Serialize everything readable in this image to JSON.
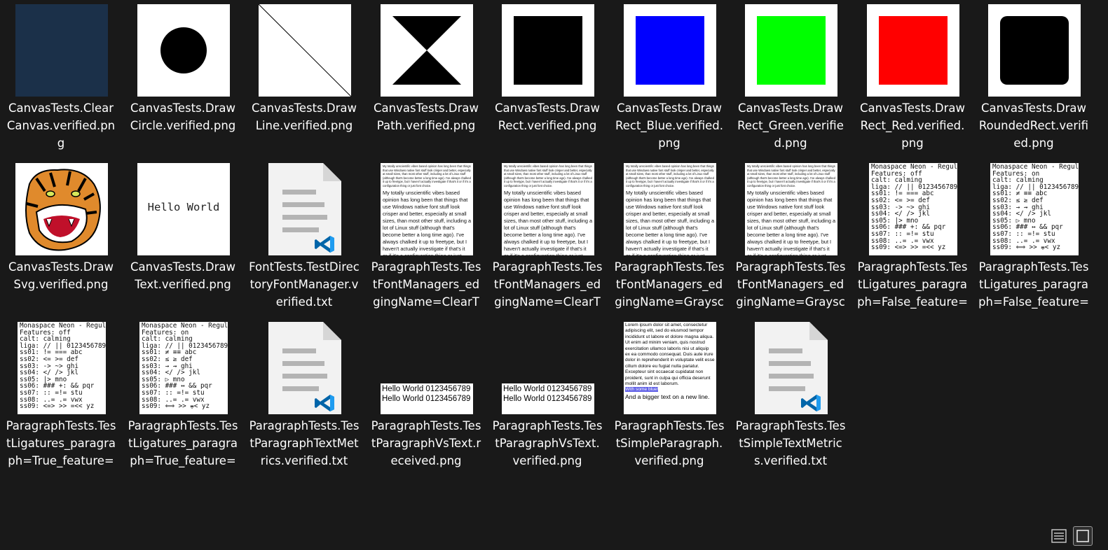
{
  "files": [
    {
      "name": "CanvasTests.ClearCanvas.verified.png",
      "label": "CanvasTests.ClearCanvas.verified.png",
      "kind": "navy"
    },
    {
      "name": "CanvasTests.DrawCircle.verified.png",
      "label": "CanvasTests.DrawCircle.verified.png",
      "kind": "circle"
    },
    {
      "name": "CanvasTests.DrawLine.verified.png",
      "label": "CanvasTests.DrawLine.verified.png",
      "kind": "line"
    },
    {
      "name": "CanvasTests.DrawPath.verified.png",
      "label": "CanvasTests.DrawPath.verified.png",
      "kind": "path"
    },
    {
      "name": "CanvasTests.DrawRect.verified.png",
      "label": "CanvasTests.DrawRect.verified.png",
      "kind": "rect",
      "color": "#000000"
    },
    {
      "name": "CanvasTests.DrawRect_Blue.verified.png",
      "label": "CanvasTests.DrawRect_Blue.verified.png",
      "kind": "rect",
      "color": "#0000ff"
    },
    {
      "name": "CanvasTests.DrawRect_Green.verified.png",
      "label": "CanvasTests.DrawRect_Green.verified.png",
      "kind": "rect",
      "color": "#00ff00"
    },
    {
      "name": "CanvasTests.DrawRect_Red.verified.png",
      "label": "CanvasTests.DrawRect_Red.verified.png",
      "kind": "rect",
      "color": "#ff0000"
    },
    {
      "name": "CanvasTests.DrawRoundedRect.verified.png",
      "label": "CanvasTests.DrawRoundedRect.verified.png",
      "kind": "roundrect"
    },
    {
      "name": "CanvasTests.DrawSvg.verified.png",
      "label": "CanvasTests.DrawSvg.verified.png",
      "kind": "tiger"
    },
    {
      "name": "CanvasTests.DrawText.verified.png",
      "label": "CanvasTests.DrawText.verified.png",
      "kind": "drawtext",
      "preview": "Hello World"
    },
    {
      "name": "FontTests.TestDirectoryFontManager.verified.txt",
      "label": "FontTests.TestDirectoryFontManager.verified.txt",
      "kind": "doc"
    },
    {
      "name": "ParagraphTests.TestFontManagers_edgingName=ClearType_fontMa...",
      "label": "ParagraphTests.TestFontManagers_edgingName=ClearType_fontMa…",
      "kind": "para"
    },
    {
      "name": "ParagraphTests.TestFontManagers_edgingName=ClearType_fontMa...",
      "label": "ParagraphTests.TestFontManagers_edgingName=ClearType_fontMa…",
      "kind": "para"
    },
    {
      "name": "ParagraphTests.TestFontManagers_edgingName=Grayscale_fontMa...",
      "label": "ParagraphTests.TestFontManagers_edgingName=Grayscale_fontMa…",
      "kind": "para"
    },
    {
      "name": "ParagraphTests.TestFontManagers_edgingName=Grayscale_fontMa...",
      "label": "ParagraphTests.TestFontManagers_edgingName=Grayscale_fontMa…",
      "kind": "para"
    },
    {
      "name": "ParagraphTests.TestLigatures_paragraph=False_feature=False.verifie...",
      "label": "ParagraphTests.TestLigatures_paragraph=False_feature=False.verifie…",
      "kind": "mono",
      "variant": "off_plain"
    },
    {
      "name": "ParagraphTests.TestLigatures_paragraph=False_feature=True.verified....",
      "label": "ParagraphTests.TestLigatures_paragraph=False_feature=True.verified.…",
      "kind": "mono",
      "variant": "on_lig"
    },
    {
      "name": "ParagraphTests.TestLigatures_paragraph=True_feature=False.verified....",
      "label": "ParagraphTests.TestLigatures_paragraph=True_feature=False.verified.…",
      "kind": "mono",
      "variant": "off_plain"
    },
    {
      "name": "ParagraphTests.TestLigatures_paragraph=True_feature=True.verified....",
      "label": "ParagraphTests.TestLigatures_paragraph=True_feature=True.verified.…",
      "kind": "mono",
      "variant": "on_lig"
    },
    {
      "name": "ParagraphTests.TestParagraphTextMetrics.verified.txt",
      "label": "ParagraphTests.TestParagraphTextMetrics.verified.txt",
      "kind": "doc"
    },
    {
      "name": "ParagraphTests.TestParagraphVsText.received.png",
      "label": "ParagraphTests.TestParagraphVsText.received.png",
      "kind": "hello"
    },
    {
      "name": "ParagraphTests.TestParagraphVsText.verified.png",
      "label": "ParagraphTests.TestParagraphVsText.verified.png",
      "kind": "hello"
    },
    {
      "name": "ParagraphTests.TestSimpleParagraph.verified.png",
      "label": "ParagraphTests.TestSimpleParagraph.verified.png",
      "kind": "simplepara"
    },
    {
      "name": "ParagraphTests.TestSimpleTextMetrics.verified.txt",
      "label": "ParagraphTests.TestSimpleTextMetrics.verified.txt",
      "kind": "doc"
    }
  ],
  "previews": {
    "para_small": "My totally unscientific vibes based opinion has long been that things that use Windows native font stuff look crisper and better, especially at small sizes, than most other stuff, including a lot of Linux stuff (although that's become better a long time ago). I've always chalked it up to freetype, but I haven't actually investigate if that's it or if it's a configuration thing or just font choice.",
    "para_big": "My totally unscientific vibes based opinion has long been that things that use Windows native font stuff look crisper and better, especially at small sizes, than most other stuff, including a lot of Linux stuff (although that's become better a long time ago). I've always chalked it up to freetype, but I haven't actually investigate if that's it or if it's a configuration thing or just font choice.",
    "hello_lines": "Hello World 0123456789\nHello World 0123456789",
    "simple_para": "Lorem ipsum dolor sit amet, consectetur adipiscing elit, sed do eiusmod tempor incididunt ut labore et dolore magna aliqua. Ut enim ad minim veniam, quis nostrud exercitation ullamco laboris nisi ut aliquip ex ea commodo consequat. Duis aute irure dolor in reprehenderit in voluptate velit esse cillum dolore eu fugiat nulla pariatur. Excepteur sint occaecat cupidatat non proident, sunt in culpa qui officia deserunt mollit anim id est laborum.",
    "simple_highlight": "With some blue!",
    "simple_big": "And a bigger text on a new line.",
    "mono_off_plain": "Monaspace Neon - Regular\nFeatures: off\ncalt: calming\nliga: // || 0123456789\nss01: != === abc\nss02: <= >= def\nss03: -> ~> ghi\nss04: </ /> jkl\nss05: |> mno\nss06: ### +: && pqr\nss07: :: =!= stu\nss08: ..= .= vwx\nss09: <=> >> =<< yz",
    "mono_on_plain": "Monaspace Neon - Regular\nFeatures: on\ncalt: calming\nliga: // || 0123456789\nss01: != === abc\nss02: <= >= def\nss03: -> ~> ghi\nss04: </ /> jkl\nss05: |> mno\nss06: ### +: && pqr\nss07: :: =!= stu\nss08: ..= .= vwx\nss09: <=> >> =<< yz",
    "mono_off_lig": "Monaspace Neon - Regular\nFeatures: off\ncalt: calming\nliga: // || 0123456789\nss01: ≠ ≡≡ abc\nss02: ≤ ≥ def\nss03: → ⇝ ghi\nss04: </ /> jkl\nss05: ▷ mno\nss06: ### ↔ && pqr\nss07: :: =!= stu\nss08: ..= .= vwx\nss09: ⟺ >> ⩦< yz",
    "mono_on_lig": "Monaspace Neon - Regular\nFeatures: on\ncalt: calming\nliga: // || 0123456789\nss01: ≠ ≡≡ abc\nss02: ≤ ≥ def\nss03: → ⇝ ghi\nss04: </ /> jkl\nss05: ▷ mno\nss06: ### ↔ && pqr\nss07: :: =!= stu\nss08: ..= .= vwx\nss09: ⟺ >> ⩦< yz"
  },
  "view": {
    "details_icon": "details-view-icon",
    "large_icons_icon": "large-icons-view-icon",
    "active": "large-icons"
  },
  "colors": {
    "background": "#191919",
    "label": "#ffffff",
    "vscode_blue": "#0065a9"
  }
}
